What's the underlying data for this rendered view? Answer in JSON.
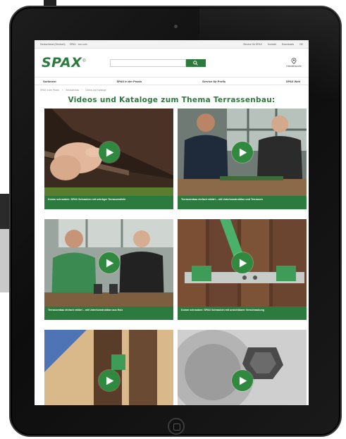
{
  "topbar": {
    "left_items": [
      "Deutschland (Deutsch)",
      "SPAX · xxx.com"
    ],
    "right_items": [
      "Service für SPAX",
      "Kontakt",
      "Downloads",
      "DE"
    ]
  },
  "header": {
    "logo_text": "SPAX",
    "logo_mark": "®",
    "search_placeholder": "",
    "dealer_label": "Händlersuche"
  },
  "nav": {
    "items": [
      "Sortiment",
      "SPAX in der Praxis",
      "Service für Profis",
      "SPAX Welt"
    ]
  },
  "breadcrumb": {
    "items": [
      "SPAX in der Praxis",
      "Terrassenbau",
      "Videos und Kataloge"
    ]
  },
  "page": {
    "title": "Videos und Kataloge zum Thema Terrassenbau:"
  },
  "cards": [
    {
      "caption": "Komm schrauben: SPAX Schrauben mit schräger Terrassendiele"
    },
    {
      "caption": "Terrassenbau einfach erklärt – mit Unterkonstruktion und Terrassen"
    },
    {
      "caption": "Terrassenbau einfach erklärt – mit Unterkonstruktion aus Holz"
    },
    {
      "caption": "Komm schrauben: SPAX Schrauben mit unsichtbarer Verschraubung"
    },
    {
      "caption": ""
    },
    {
      "caption": ""
    }
  ],
  "colors": {
    "brand_green": "#2d7a3e",
    "play_green": "#2f8a3f",
    "tablet_frame": "#111111"
  },
  "icons": [
    "search-icon",
    "location-pin-icon",
    "play-icon"
  ]
}
